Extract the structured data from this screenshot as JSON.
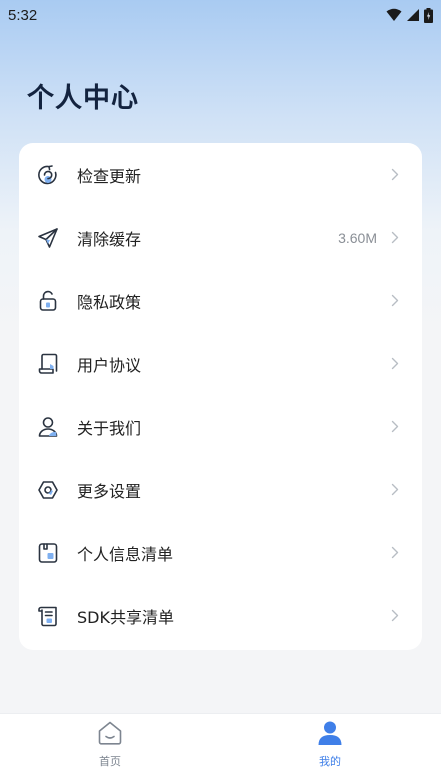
{
  "status_bar": {
    "time": "5:32"
  },
  "header": {
    "title": "个人中心"
  },
  "menu": {
    "items": [
      {
        "label": "检查更新",
        "value": "",
        "icon": "update-check-icon"
      },
      {
        "label": "清除缓存",
        "value": "3.60M",
        "icon": "send-icon"
      },
      {
        "label": "隐私政策",
        "value": "",
        "icon": "lock-icon"
      },
      {
        "label": "用户协议",
        "value": "",
        "icon": "agreement-icon"
      },
      {
        "label": "关于我们",
        "value": "",
        "icon": "person-icon"
      },
      {
        "label": "更多设置",
        "value": "",
        "icon": "settings-icon"
      },
      {
        "label": "个人信息清单",
        "value": "",
        "icon": "info-list-icon"
      },
      {
        "label": "SDK共享清单",
        "value": "",
        "icon": "sdk-list-icon"
      }
    ]
  },
  "bottom_nav": {
    "home_label": "首页",
    "mine_label": "我的",
    "active": "mine"
  },
  "colors": {
    "accent": "#3f7fe8",
    "title": "#13233f",
    "inactive": "#7d8590"
  }
}
